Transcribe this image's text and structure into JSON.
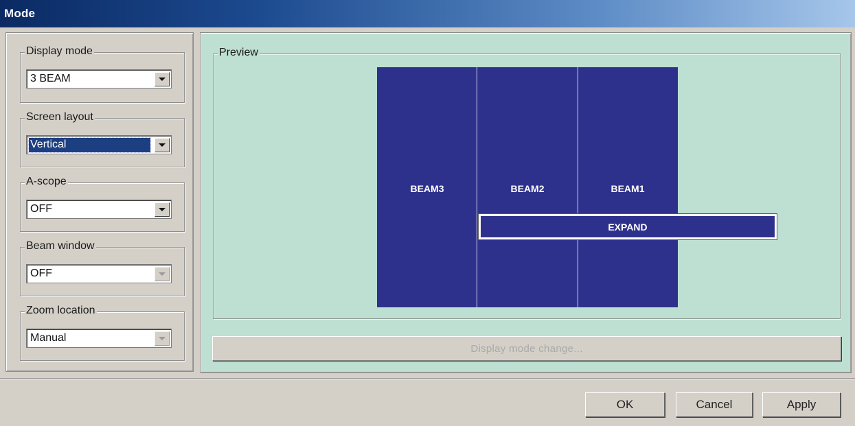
{
  "window": {
    "title": "Mode"
  },
  "left": {
    "groups": [
      {
        "label": "Display mode",
        "value": "3 BEAM",
        "selected": false,
        "disabled": false
      },
      {
        "label": "Screen layout",
        "value": "Vertical",
        "selected": true,
        "disabled": false
      },
      {
        "label": "A-scope",
        "value": "OFF",
        "selected": false,
        "disabled": false
      },
      {
        "label": "Beam window",
        "value": "OFF",
        "selected": false,
        "disabled": true
      },
      {
        "label": "Zoom location",
        "value": "Manual",
        "selected": false,
        "disabled": true
      }
    ]
  },
  "preview": {
    "label": "Preview",
    "beams": [
      "BEAM3",
      "BEAM2",
      "BEAM1"
    ],
    "expand_label": "EXPAND",
    "beam_color": "#2e318c",
    "background_color": "#bde0d2"
  },
  "display_mode_change_label": "Display mode change...",
  "footer": {
    "ok_label": "OK",
    "cancel_label": "Cancel",
    "apply_label": "Apply"
  }
}
